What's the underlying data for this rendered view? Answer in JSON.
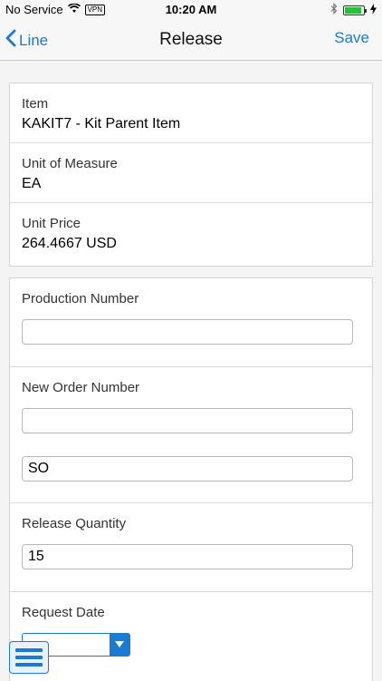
{
  "status_bar": {
    "carrier": "No Service",
    "vpn": "VPN",
    "time": "10:20 AM",
    "battery_level": 0.9,
    "battery_color": "#22c33a"
  },
  "nav": {
    "back_label": "Line",
    "title": "Release",
    "save_label": "Save",
    "accent_color": "#1b7bd3"
  },
  "info": {
    "item_label": "Item",
    "item_value": "KAKIT7 - Kit Parent Item",
    "uom_label": "Unit of Measure",
    "uom_value": "EA",
    "price_label": "Unit Price",
    "price_value": "264.4667 USD"
  },
  "form": {
    "production_number_label": "Production Number",
    "production_number_value": "",
    "new_order_number_label": "New Order Number",
    "new_order_number_value": "",
    "order_type_value": "SO",
    "release_quantity_label": "Release Quantity",
    "release_quantity_value": "15",
    "request_date_label": "Request Date",
    "request_date_value": ""
  },
  "icons": {
    "back": "chevron-left-icon",
    "wifi": "wifi-icon",
    "bluetooth": "bluetooth-icon",
    "battery": "battery-icon",
    "charging": "charging-bolt-icon",
    "dropdown": "chevron-down-icon",
    "menu": "hamburger-menu-icon"
  }
}
